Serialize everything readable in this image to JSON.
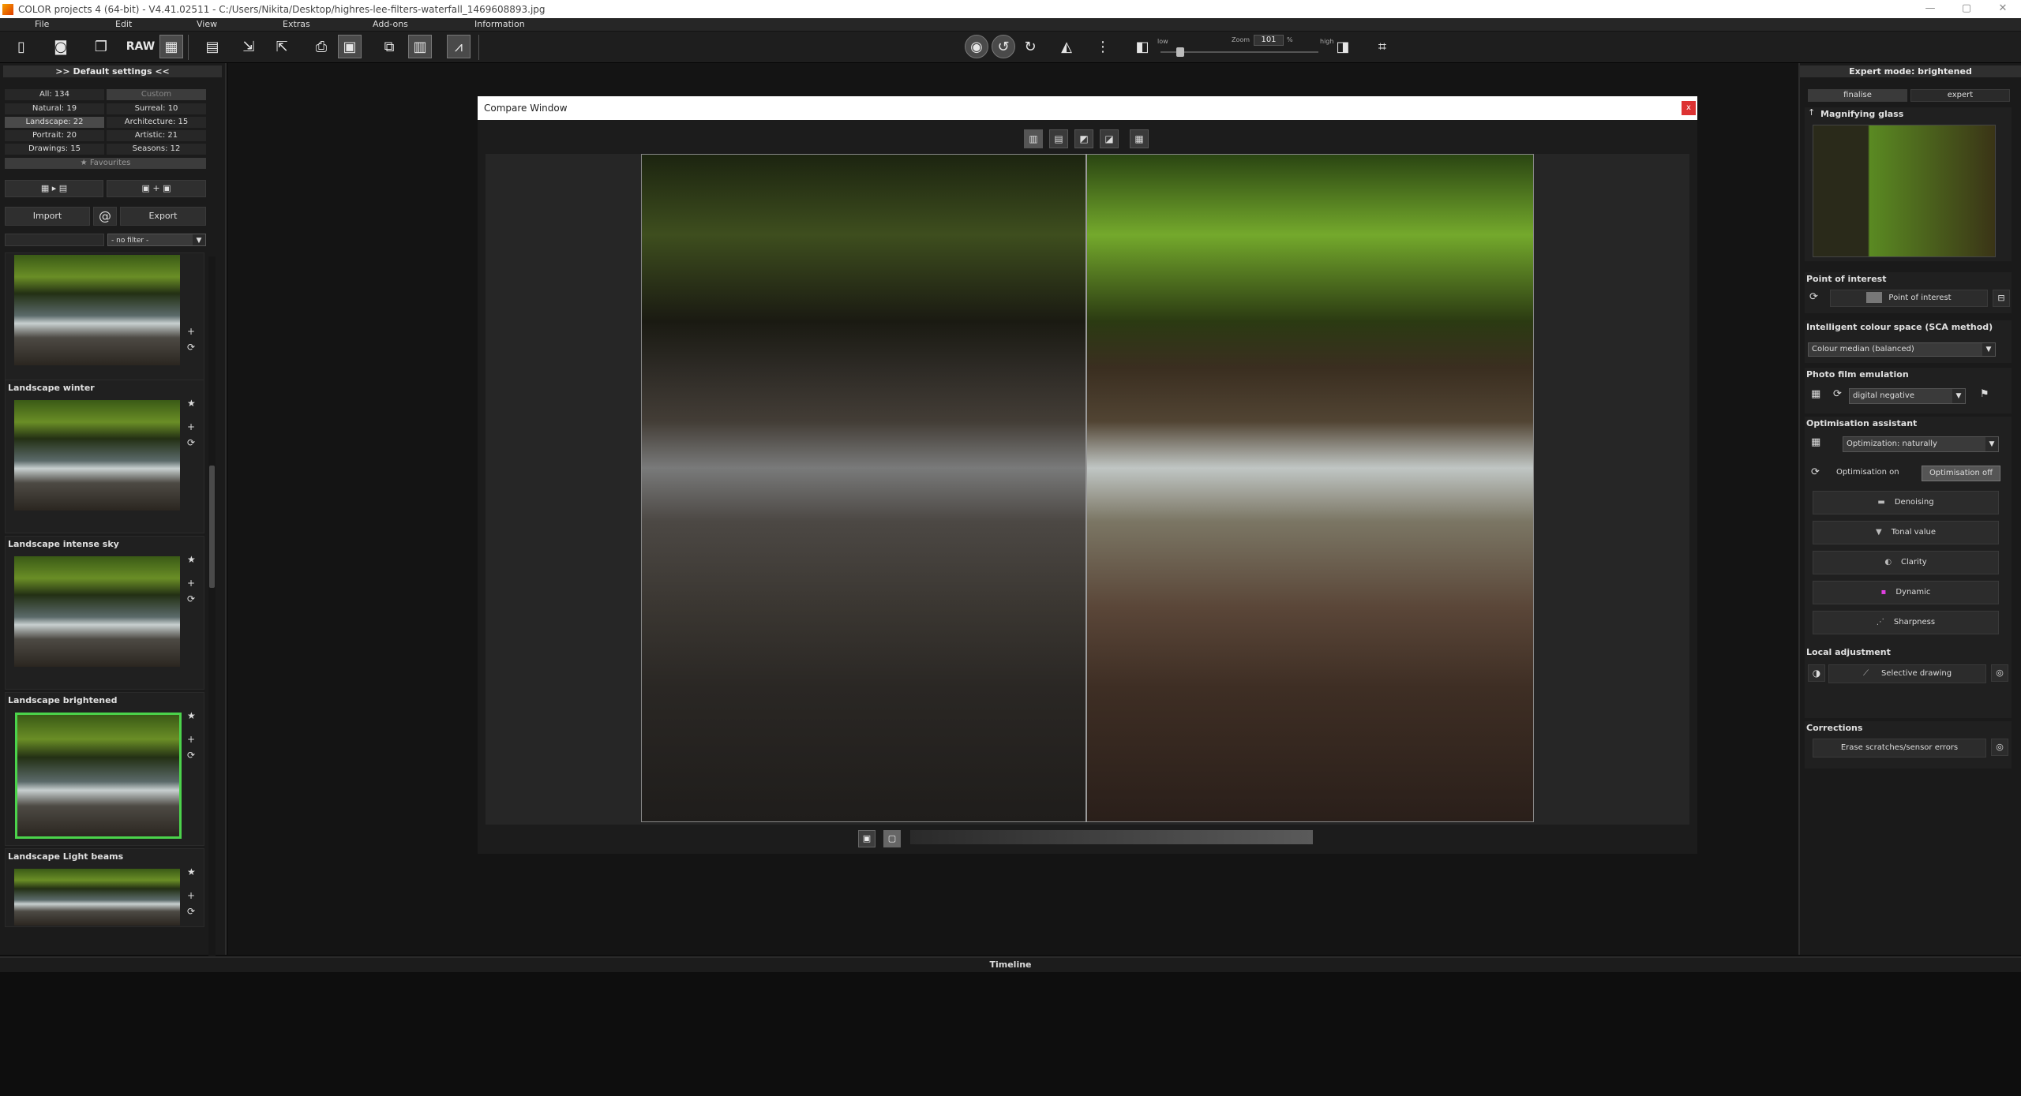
{
  "window": {
    "title": "COLOR projects 4 (64-bit) - V4.41.02511 - C:/Users/Nikita/Desktop/highres-lee-filters-waterfall_1469608893.jpg",
    "minimize": "—",
    "maximize": "▢",
    "close": "✕"
  },
  "menu": [
    "File",
    "Edit",
    "View",
    "Extras",
    "Add-ons",
    "Information"
  ],
  "toolbar": {
    "raw_label": "RAW",
    "zoom_label": "Zoom",
    "zoom_value": "101",
    "zoom_unit": "%",
    "low_label": "low",
    "high_label": "high"
  },
  "left_panel": {
    "header": ">> Default settings <<",
    "categories": [
      {
        "label": "All: 134"
      },
      {
        "label": "Custom"
      },
      {
        "label": "Natural: 19"
      },
      {
        "label": "Surreal: 10"
      },
      {
        "label": "Landscape: 22"
      },
      {
        "label": "Architecture: 15"
      },
      {
        "label": "Portrait: 20"
      },
      {
        "label": "Artistic: 21"
      },
      {
        "label": "Drawings: 15"
      },
      {
        "label": "Seasons: 12"
      }
    ],
    "favourites": "★ Favourites",
    "import": "Import",
    "export": "Export",
    "at": "@",
    "filter": "- no filter -",
    "presets": [
      {
        "title": ""
      },
      {
        "title": "Landscape winter"
      },
      {
        "title": "Landscape intense sky"
      },
      {
        "title": "Landscape brightened"
      },
      {
        "title": "Landscape Light beams"
      }
    ],
    "icons": {
      "star": "★",
      "plus": "+",
      "refresh": "⟳"
    }
  },
  "compare": {
    "title": "Compare Window",
    "close": "x"
  },
  "right_panel": {
    "header": "Expert mode: brightened",
    "tab_finalise": "finalise",
    "tab_expert": "expert",
    "magnifier": "Magnifying glass",
    "poi_title": "Point of interest",
    "poi_button": "Point of interest",
    "sca_title": "Intelligent colour space (SCA method)",
    "sca_value": "Colour median (balanced)",
    "film_title": "Photo film emulation",
    "film_value": "digital negative",
    "opt_title": "Optimisation assistant",
    "opt_value": "Optimization: naturally",
    "opt_on": "Optimisation on",
    "opt_off": "Optimisation off",
    "opt_items": [
      "Denoising",
      "Tonal value",
      "Clarity",
      "Dynamic",
      "Sharpness"
    ],
    "local_title": "Local adjustment",
    "selective": "Selective drawing",
    "corr_title": "Corrections",
    "erase": "Erase scratches/sensor errors"
  },
  "timeline": {
    "title": "Timeline"
  }
}
